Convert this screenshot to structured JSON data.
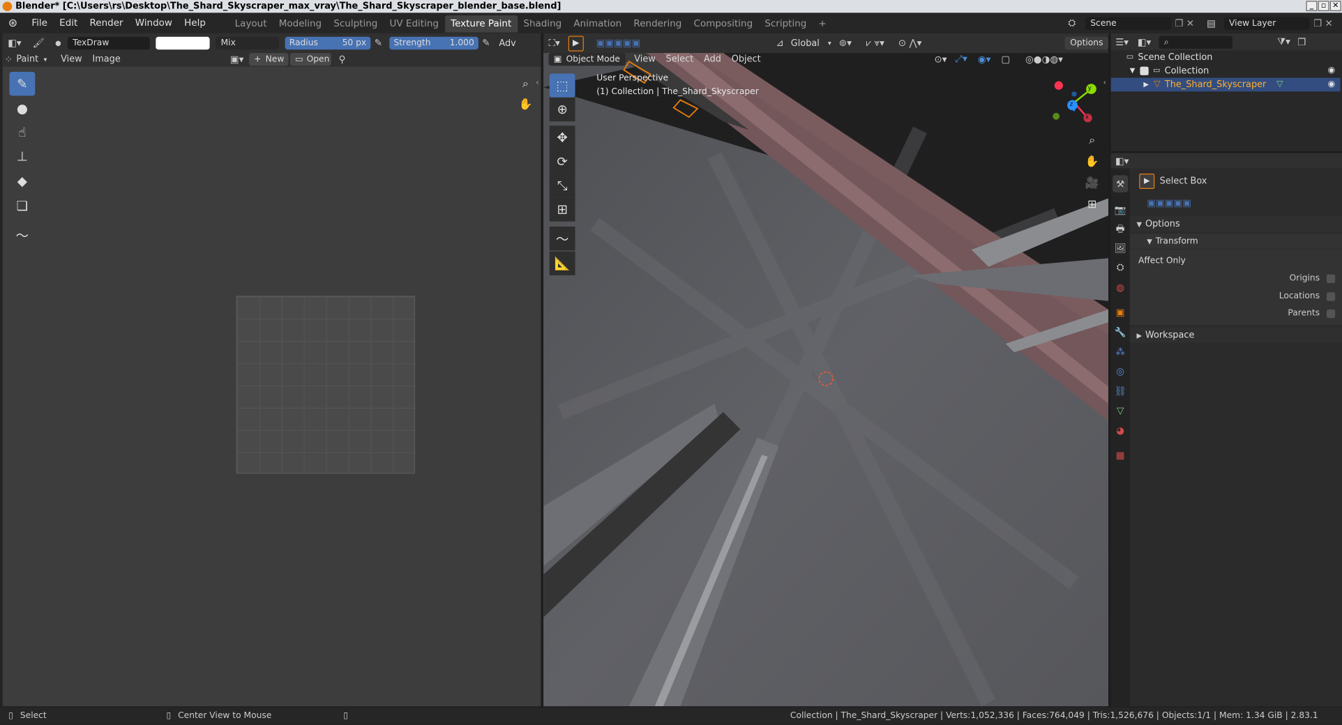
{
  "window": {
    "title": "Blender* [C:\\Users\\rs\\Desktop\\The_Shard_Skyscraper_max_vray\\The_Shard_Skyscraper_blender_base.blend]",
    "controls": [
      "_",
      "▫",
      "✕"
    ]
  },
  "topbar": {
    "menus": [
      "File",
      "Edit",
      "Render",
      "Window",
      "Help"
    ],
    "workspaces": [
      "Layout",
      "Modeling",
      "Sculpting",
      "UV Editing",
      "Texture Paint",
      "Shading",
      "Animation",
      "Rendering",
      "Compositing",
      "Scripting"
    ],
    "active_workspace": "Texture Paint",
    "add_tab": "+",
    "scene": "Scene",
    "view_layer": "View Layer"
  },
  "image_editor": {
    "brush_name": "TexDraw",
    "blend_mode": "Mix",
    "radius_label": "Radius",
    "radius_value": "50 px",
    "strength_label": "Strength",
    "strength_value": "1.000",
    "adv_label": "Adv",
    "mode": "Paint",
    "menus": [
      "View",
      "Image"
    ],
    "new_label": "New",
    "open_label": "Open"
  },
  "viewport": {
    "mode": "Object Mode",
    "menus": [
      "View",
      "Select",
      "Add",
      "Object"
    ],
    "orientation": "Global",
    "options_label": "Options",
    "perspective_label": "User Perspective",
    "collection_label": "(1) Collection | The_Shard_Skyscraper",
    "axes": {
      "x": "x",
      "y": "y",
      "z": "z"
    }
  },
  "outliner": {
    "scene_collection": "Scene Collection",
    "collection": "Collection",
    "object": "The_Shard_Skyscraper"
  },
  "properties": {
    "tool_name": "Select Box",
    "options_label": "Options",
    "transform_label": "Transform",
    "affect_only_label": "Affect Only",
    "origins_label": "Origins",
    "locations_label": "Locations",
    "parents_label": "Parents",
    "workspace_label": "Workspace"
  },
  "status": {
    "select": "Select",
    "center_view": "Center View to Mouse",
    "stats": "Collection | The_Shard_Skyscraper | Verts:1,052,336 | Faces:764,049 | Tris:1,526,676 | Objects:1/1 | Mem: 1.34 GiB | 2.83.1"
  },
  "colors": {
    "accent": "#4772b3",
    "selected_object": "#e87d0d",
    "axis_x": "#ff3352",
    "axis_y": "#8bdc00",
    "axis_z": "#2890ff"
  }
}
